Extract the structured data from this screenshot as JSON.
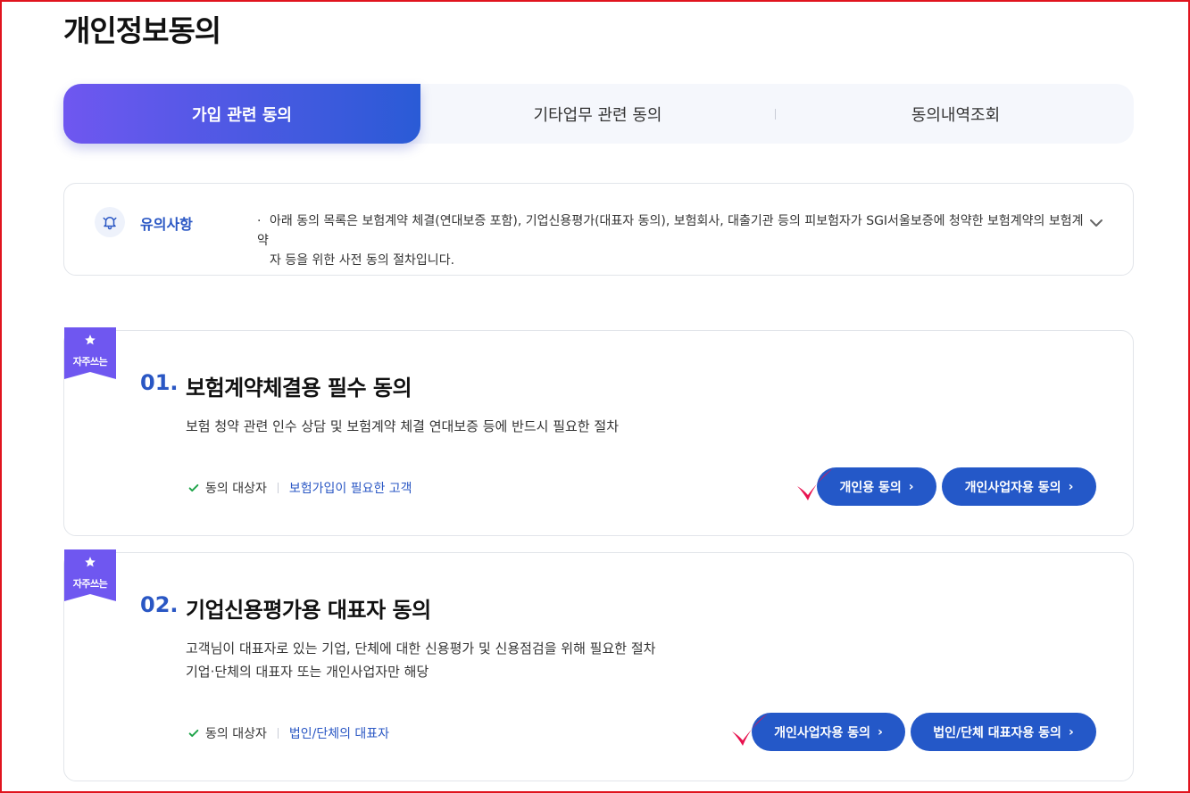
{
  "page": {
    "title": "개인정보동의"
  },
  "tabs": [
    {
      "label": "가입 관련 동의",
      "active": true
    },
    {
      "label": "기타업무 관련 동의",
      "active": false
    },
    {
      "label": "동의내역조회",
      "active": false
    }
  ],
  "notice": {
    "label": "유의사항",
    "bullet": "·",
    "line1": "아래 동의 목록은 보험계약 체결(연대보증 포함), 기업신용평가(대표자 동의), 보험회사, 대출기관 등의 피보험자가 SGI서울보증에 청약한 보험계약의 보험계약",
    "line2": "자 등을 위한 사전 동의 절차입니다.",
    "icon": "bell-icon",
    "toggle_icon": "chevron-down-icon"
  },
  "ribbon": {
    "label": "자주쓰는",
    "color": "#6f57f0"
  },
  "cards": [
    {
      "number": "01.",
      "title": "보험계약체결용 필수 동의",
      "desc_lines": [
        "보험 청약 관련 인수 상담 및 보험계약 체결 연대보증 등에 반드시 필요한 절차"
      ],
      "target_label": "동의 대상자",
      "target_value": "보험가입이 필요한 고객",
      "buttons": [
        "개인용 동의",
        "개인사업자용 동의"
      ]
    },
    {
      "number": "02.",
      "title": "기업신용평가용 대표자 동의",
      "desc_lines": [
        "고객님이 대표자로 있는 기업, 단체에 대한 신용평가 및 신용점검을 위해 필요한 절차",
        "기업·단체의 대표자 또는 개인사업자만 해당"
      ],
      "target_label": "동의 대상자",
      "target_value": "법인/단체의 대표자",
      "buttons": [
        "개인사업자용 동의",
        "법인/단체 대표자용 동의"
      ]
    }
  ],
  "colors": {
    "primary": "#2458c8",
    "accent": "#2a57c4",
    "annotation": "#e8124f",
    "frame": "#e0141e"
  }
}
